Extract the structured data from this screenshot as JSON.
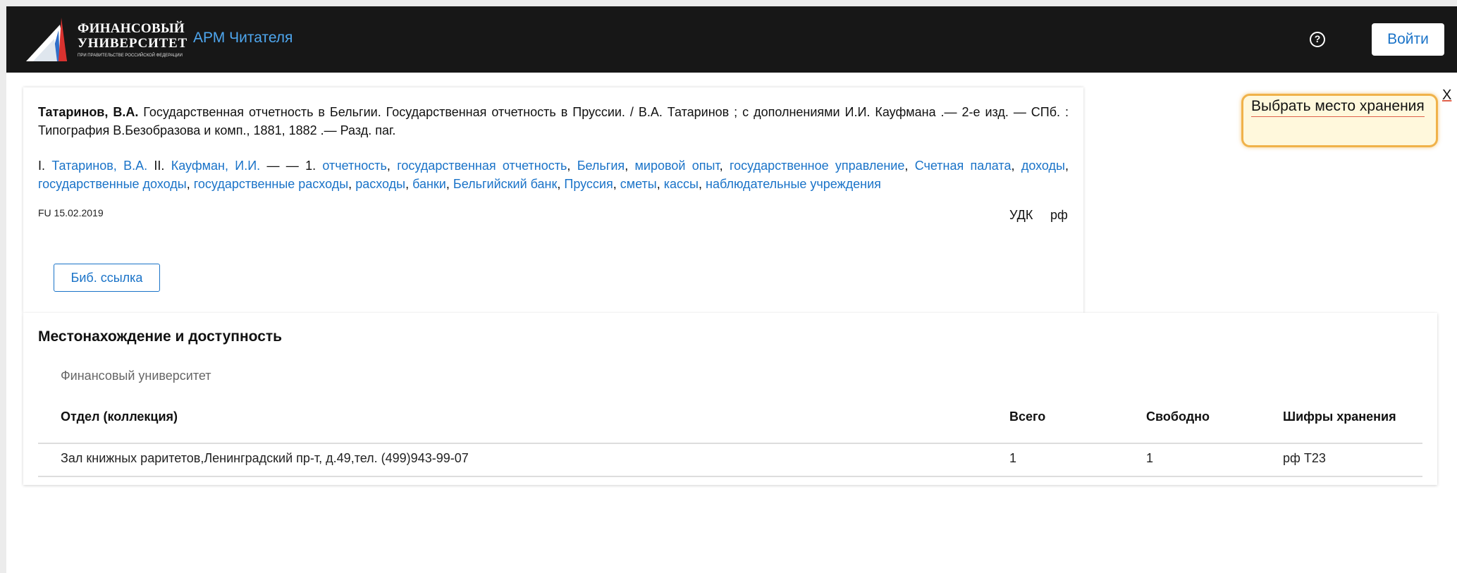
{
  "header": {
    "logo_line1": "ФИНАНСОВЫЙ",
    "logo_line2": "УНИВЕРСИТЕТ",
    "logo_line3": "ПРИ ПРАВИТЕЛЬСТВЕ РОССИЙСКОЙ ФЕДЕРАЦИИ",
    "app_title": "АРМ Читателя",
    "help_icon": "?",
    "login_label": "Войти"
  },
  "record": {
    "author": "Татаринов, В.А.",
    "description": " Государственная отчетность в Бельгии. Государственная отчетность в Пруссии. / В.А. Татаринов ; с дополнениями И.И. Кауфмана .— 2-е изд. — СПб. : Типография В.Безобразова и комп., 1881, 1882 .— Разд. паг.",
    "entry_prefix": "I. ",
    "entry_author1": "Татаринов, В.А.",
    "entry_sep1": " II. ",
    "entry_author2": "Кауфман, И.И.",
    "entry_sep2": " — —  1. ",
    "subjects": [
      "отчетность",
      "государственная отчетность",
      "Бельгия",
      "мировой опыт",
      "государственное управление",
      "Счетная палата",
      "доходы",
      "государственные доходы",
      "государственные расходы",
      "расходы",
      "банки",
      "Бельгийский банк",
      "Пруссия",
      "сметы",
      "кассы",
      "наблюдательные учреждения"
    ],
    "comma": ", ",
    "date": "FU 15.02.2019",
    "udk_label": "УДК",
    "rf_label": "рф",
    "bib_button": "Биб. ссылка"
  },
  "holdings": {
    "title": "Местонахождение и доступность",
    "library": "Финансовый университет",
    "columns": [
      "Отдел (коллекция)",
      "Всего",
      "Свободно",
      "Шифры хранения"
    ],
    "rows": [
      {
        "department": "Зал книжных раритетов,Ленинградский пр-т, д.49,тел. (499)943-99-07",
        "total": "1",
        "available": "1",
        "shelfmark": "рф Т23"
      }
    ]
  },
  "side": {
    "label": "Выбрать место хранения",
    "close": "X"
  },
  "colors": {
    "header_bg": "#171717",
    "link": "#1a73c8",
    "accent_orange": "#f0b24a"
  }
}
